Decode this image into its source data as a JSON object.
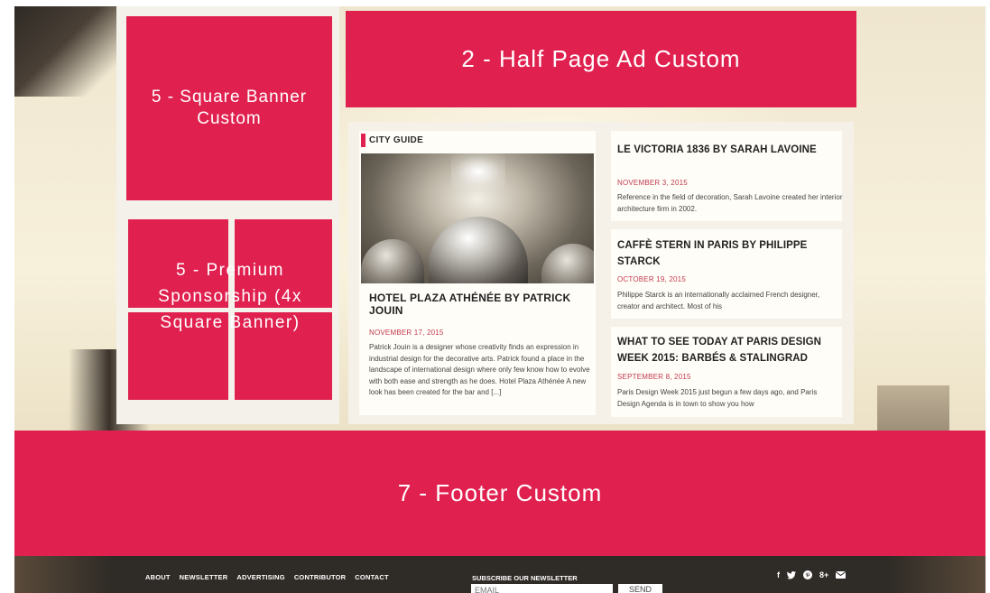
{
  "ads": {
    "square_banner": "5 - Square Banner Custom",
    "premium": "5 - Premium Sponsorship (4x Square Banner)",
    "half_page": "2 - Half Page Ad Custom",
    "footer": "7 - Footer Custom"
  },
  "city_guide": {
    "tag": "CITY GUIDE",
    "title": "HOTEL PLAZA ATHÉNÉE BY PATRICK JOUIN",
    "date": "NOVEMBER 17, 2015",
    "excerpt": "Patrick Jouin is a designer whose creativity finds an expression in industrial design for the decorative arts. Patrick found a place in the landscape of international design where only few know how to evolve with both ease and strength as he does. Hotel Plaza Athénée A new look has been created for the bar and [...]"
  },
  "articles": [
    {
      "title": "LE VICTORIA 1836 BY SARAH LAVOINE",
      "date": "NOVEMBER 3, 2015",
      "excerpt": "Reference in the field of decoration, Sarah Lavoine created her interior architecture firm in 2002."
    },
    {
      "title": "CAFFÈ STERN IN PARIS BY PHILIPPE STARCK",
      "date": "OCTOBER 19, 2015",
      "excerpt": "Philippe Starck is an internationally acclaimed French designer, creator and architect. Most of his"
    },
    {
      "title": "WHAT TO SEE TODAY AT PARIS DESIGN WEEK 2015: BARBÉS & STALINGRAD",
      "date": "SEPTEMBER 8, 2015",
      "excerpt": "Paris Design Week 2015 just begun a few days ago, and Paris Design Agenda is in town to show you how"
    }
  ],
  "footer": {
    "nav": [
      "ABOUT",
      "NEWSLETTER",
      "ADVERTISING",
      "CONTRIBUTOR",
      "CONTACT"
    ],
    "subscribe_label": "SUBSCRIBE OUR NEWSLETTER",
    "email_placeholder": "EMAIL",
    "send_label": "SEND",
    "social": {
      "facebook": "f",
      "googleplus": "8+"
    },
    "social_icons": [
      "facebook-icon",
      "twitter-icon",
      "pinterest-icon",
      "google-plus-icon",
      "mail-icon"
    ]
  },
  "colors": {
    "accent": "#e0214f",
    "date": "#c23a4f",
    "footer_bar": "#2f2b26"
  }
}
